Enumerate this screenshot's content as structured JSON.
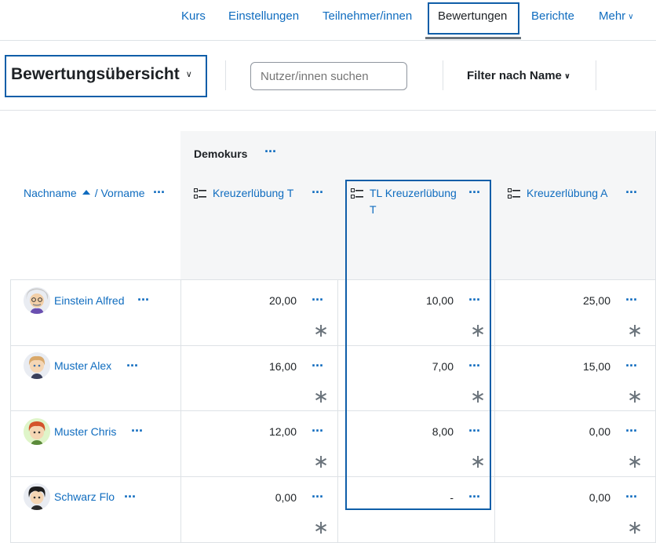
{
  "nav": {
    "items": [
      "Kurs",
      "Einstellungen",
      "Teilnehmer/innen",
      "Bewertungen",
      "Berichte",
      "Mehr"
    ],
    "active": "Bewertungen"
  },
  "tertiary": {
    "title": "Bewertungsübersicht",
    "search_placeholder": "Nutzer/innen suchen",
    "filter_label": "Filter nach Name"
  },
  "grid": {
    "course": "Demokurs",
    "name_col": {
      "lastname": "Nachname",
      "firstname": "/ Vorname"
    },
    "columns": [
      "Kreuzerlübung T",
      "TL Kreuzerlübung T",
      "Kreuzerlübung A"
    ],
    "rows": [
      {
        "name": "Einstein Alfred",
        "grades": [
          "20,00",
          "10,00",
          "25,00"
        ]
      },
      {
        "name": "Muster Alex",
        "grades": [
          "16,00",
          "7,00",
          "15,00"
        ]
      },
      {
        "name": "Muster Chris",
        "grades": [
          "12,00",
          "8,00",
          "0,00"
        ]
      },
      {
        "name": "Schwarz Flo",
        "grades": [
          "0,00",
          "-",
          "0,00"
        ]
      }
    ]
  },
  "icons": {
    "menu": "ellipsis-icon",
    "item": "assignment-icon",
    "overridden": "asterisk-icon",
    "sort": "sort-ascending-icon"
  },
  "colors": {
    "link": "#0f6cbf",
    "highlight": "#0f5ea8",
    "text": "#1d2125"
  }
}
